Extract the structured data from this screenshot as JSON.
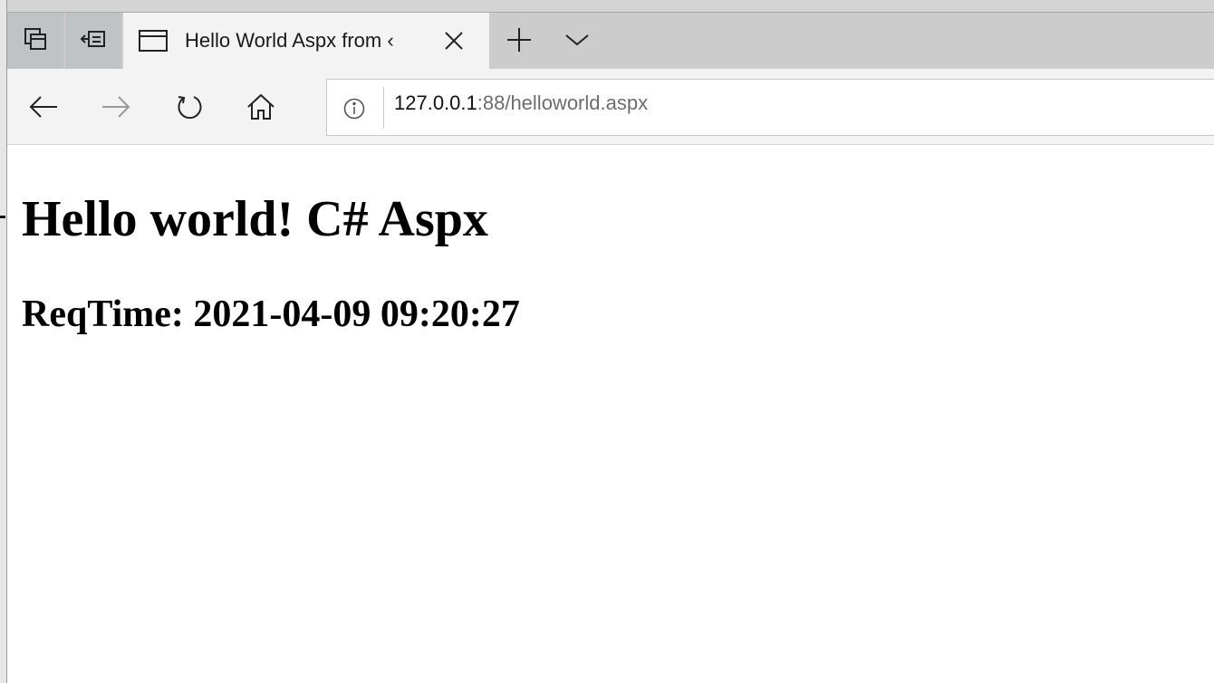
{
  "browser": {
    "tabbar": {
      "tab": {
        "title": "Hello World Aspx from ‹"
      },
      "icons": [
        "tab-preview-icon",
        "set-aside-tabs-icon",
        "page-icon",
        "close-icon",
        "plus-icon",
        "chevron-down-icon"
      ]
    },
    "navbar": {
      "icons": [
        "back-arrow-icon",
        "forward-arrow-icon",
        "refresh-icon",
        "home-icon",
        "info-icon"
      ]
    },
    "address": {
      "host": "127.0.0.1",
      "path": ":88/helloworld.aspx"
    }
  },
  "page": {
    "heading": "Hello world! C# Aspx",
    "req_time": "ReqTime: 2021-04-09 09:20:27"
  },
  "colors": {
    "tab_active_bg": "#f3f3f3",
    "tabbar_bg": "#cccccc",
    "url_path": "#6d6d6d"
  }
}
